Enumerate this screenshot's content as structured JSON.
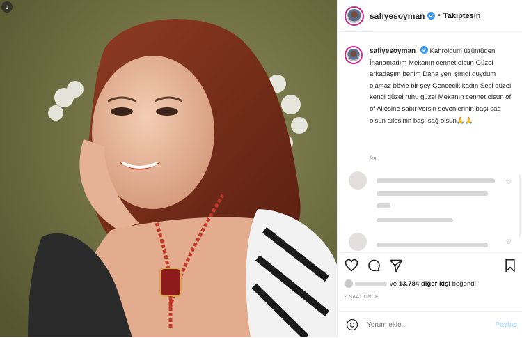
{
  "post": {
    "username": "safiyesoyman",
    "follow_state": "Takiptesin",
    "separator": "•",
    "caption": "Kahroldum üzüntüden İnanamadım Mekanın cennet olsun Güzel arkadaşım benim Daha yeni şimdi duydum olamaz böyle bir şey Gencecik kadın Sesi güzel kendi güzel ruhu güzel Mekanın cennet olsun of of Ailesine sabır versin sevenlerinin başı sağ olsun ailesinin başı sağ olsun🙏🙏",
    "time_short": "9s",
    "likes_and": "ve",
    "likes_count": "13.784",
    "likes_rest": "diğer kişi",
    "likes_verb": "beğendi",
    "time_ago": "9 SAAT ÖNCE",
    "comment_placeholder": "Yorum ekle...",
    "post_button": "Paylaş"
  },
  "colors": {
    "accent_link": "#b3dbff",
    "verified": "#3897f0",
    "story_ring": "#c72a8e",
    "background_photo": "#6f6f44"
  },
  "icons": [
    "heart-icon",
    "comment-icon",
    "share-icon",
    "bookmark-icon",
    "smile-icon",
    "verified-badge-icon",
    "corner-info-icon"
  ]
}
